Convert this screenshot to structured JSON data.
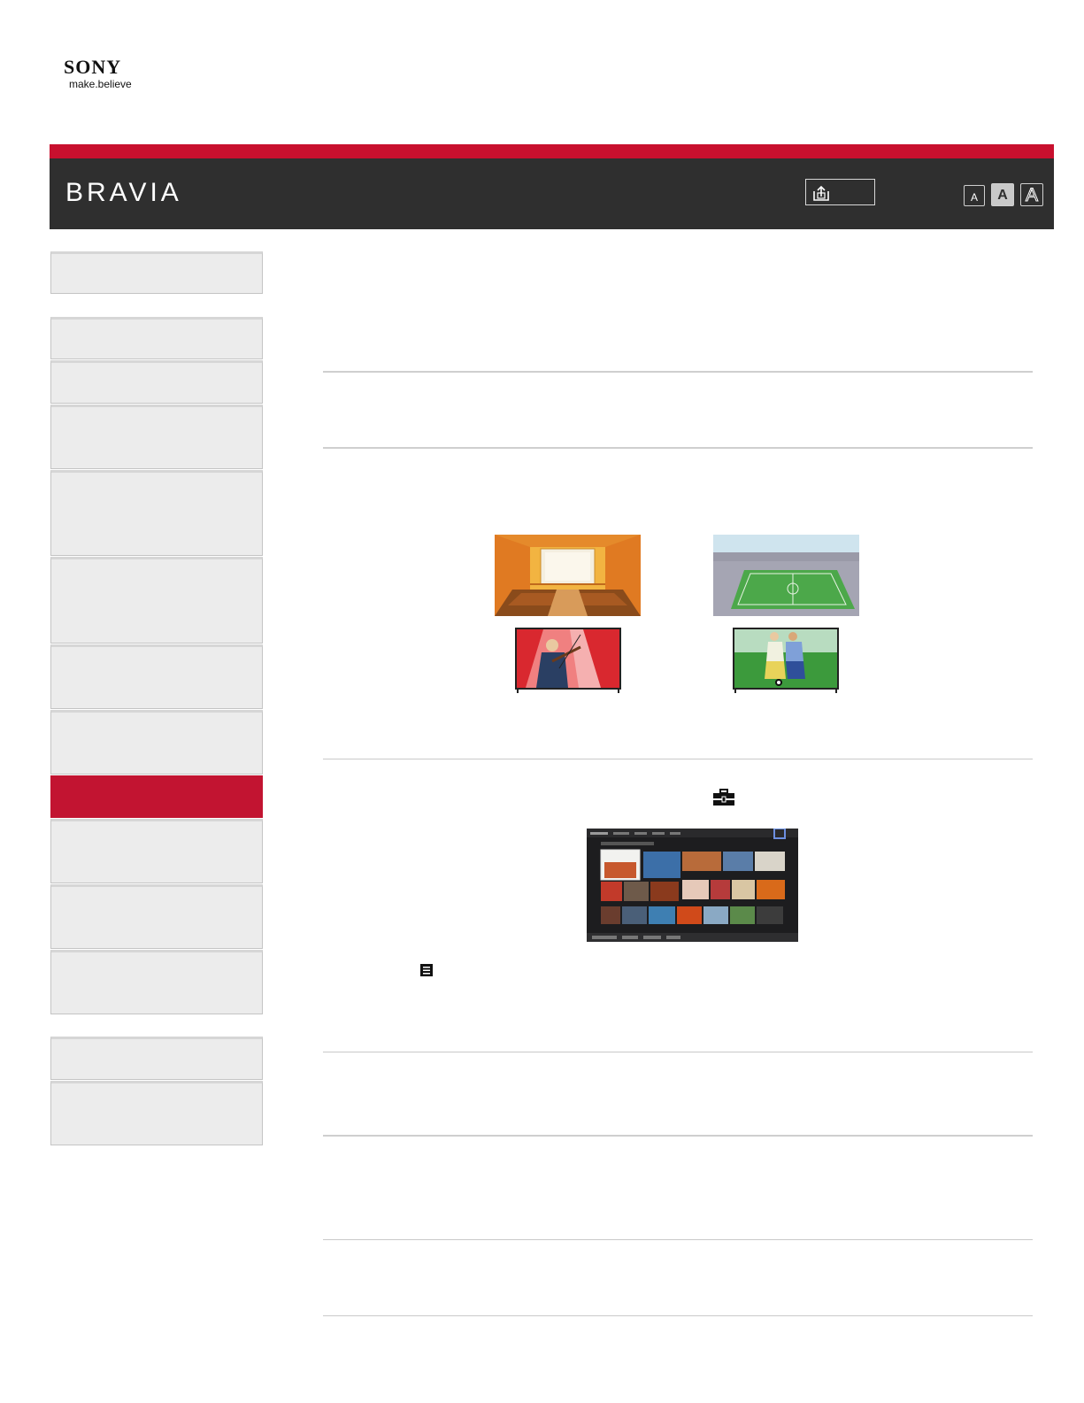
{
  "brand": {
    "logo_text": "SONY",
    "tagline": "make.believe",
    "product": "BRAVIA"
  },
  "header": {
    "font_size_small": "A",
    "font_size_medium": "A",
    "font_size_large": "A"
  },
  "sidebar": {
    "items": [
      {
        "label": "",
        "active": false
      },
      {
        "label": "",
        "active": false
      },
      {
        "label": "",
        "active": false
      },
      {
        "label": "",
        "active": false
      },
      {
        "label": "",
        "active": false
      },
      {
        "label": "",
        "active": false
      },
      {
        "label": "",
        "active": false
      },
      {
        "label": "",
        "active": false
      },
      {
        "label": "",
        "active": true
      },
      {
        "label": "",
        "active": false
      },
      {
        "label": "",
        "active": false
      },
      {
        "label": "",
        "active": false
      },
      {
        "label": "",
        "active": false
      },
      {
        "label": "",
        "active": false
      }
    ]
  },
  "icons": {
    "upload": "upload-icon",
    "toolbox": "toolbox-icon",
    "options": "options-list-icon"
  },
  "colors": {
    "brand_red": "#c8102e",
    "header_bg": "#2f2f2f",
    "sidebar_bg": "#ececec",
    "active_item": "#c21431"
  }
}
